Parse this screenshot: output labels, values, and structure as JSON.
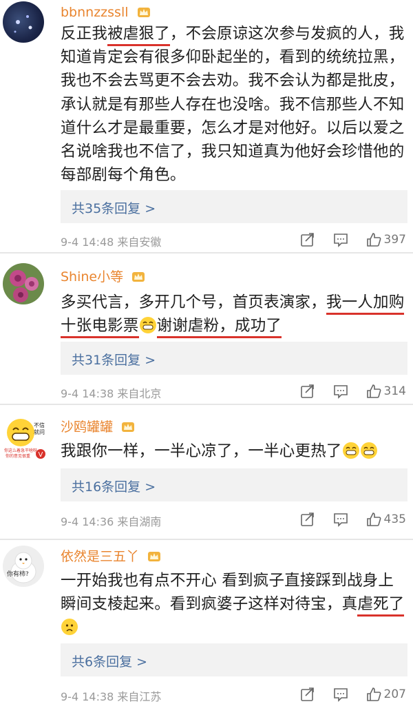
{
  "comments": [
    {
      "username": "bbnnzzssll",
      "segments": [
        "反正我",
        "被虐狠了",
        "，不会原谅这次参与发疯的人，我知道肯定会有很多仰卧起坐的，看到的统统拉黑，我也不会去骂更不会去劝。我不会认为都是批皮，承认就是有那些人存在也没啥。我不信那些人不知道什么才是最重要，怎么才是对他好。以后以爱之名说啥我也不信了，我只知道真为他好会珍惜他的每部剧每个角色。"
      ],
      "replies": "共35条回复 >",
      "time": "9-4 14:48",
      "source": "来自安徽",
      "likes": "397"
    },
    {
      "username": "Shine小等",
      "segments": [
        "多买代言，多开几个号，首页表演家，",
        "我一人加购十张电影票",
        "谢谢虐粉，成功了"
      ],
      "replies": "共31条回复 >",
      "time": "9-4 14:38",
      "source": "来自北京",
      "likes": "314"
    },
    {
      "username": "沙鸥罐罐",
      "segments": [
        "我跟你一样，一半心凉了，一半心更热了"
      ],
      "replies": "共16条回复 >",
      "time": "9-4 14:36",
      "source": "来自湖南",
      "likes": "435",
      "avatar_text": [
        "不信",
        "就问",
        "你这么着急干啥呀",
        "你的意见很重"
      ]
    },
    {
      "username": "依然是三五丫",
      "segments": [
        "一开始我也有点不开心 看到疯子直接踩到战身上 瞬间支棱起来。看到疯婆子这样对待宝，真",
        "虐死了"
      ],
      "replies": "共6条回复 >",
      "time": "9-4 14:38",
      "source": "来自江苏",
      "likes": "207",
      "avatar_text": "你有柿?"
    }
  ],
  "colors": {
    "username": "#e9852f",
    "reply_link": "#4a6f9f",
    "underline": "#d9322b",
    "reply_bg": "#f2f2f2",
    "meta": "#9a9a9a"
  },
  "icons": [
    "crown-badge-icon",
    "share-icon",
    "comment-icon",
    "like-icon",
    "grin-emoji-icon",
    "worried-emoji-icon"
  ]
}
